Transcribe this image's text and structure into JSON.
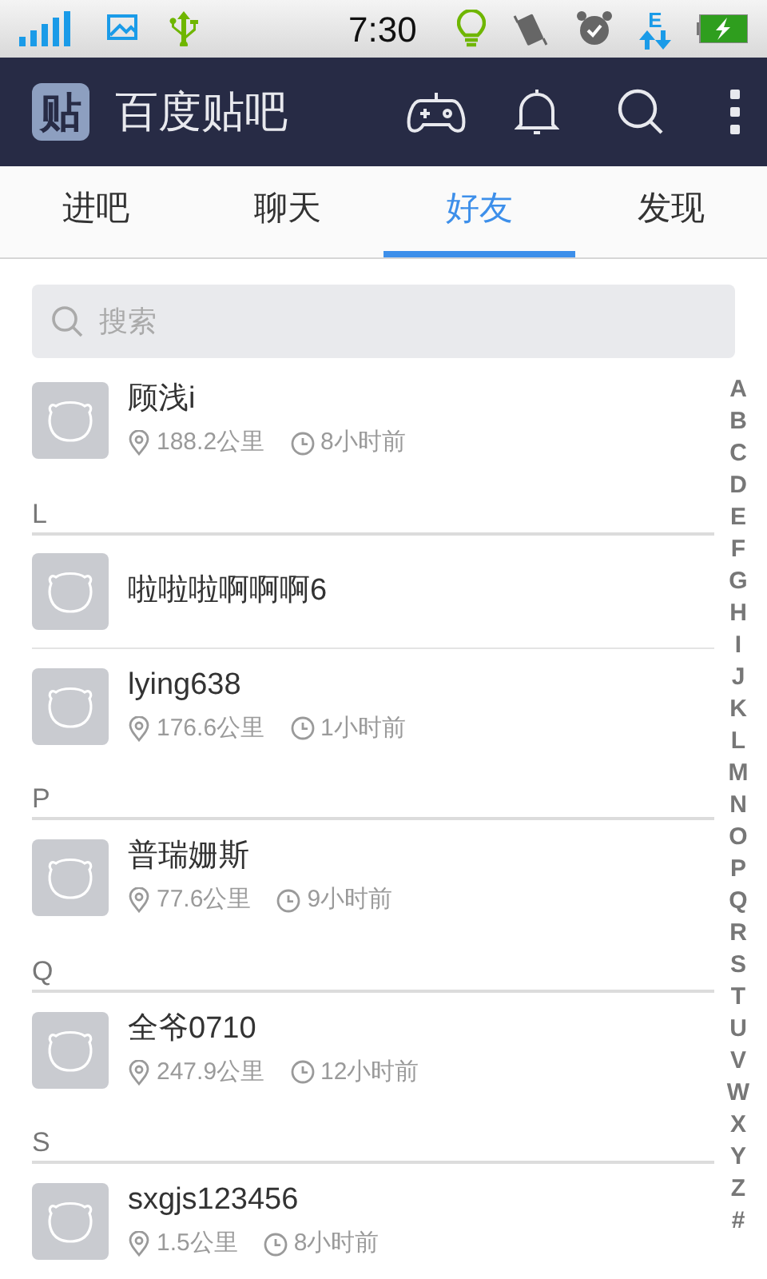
{
  "status_bar": {
    "time": "7:30",
    "network_type": "E"
  },
  "header": {
    "logo": "贴",
    "title": "百度贴吧"
  },
  "tabs": [
    {
      "label": "进吧",
      "selected": false
    },
    {
      "label": "聊天",
      "selected": false
    },
    {
      "label": "好友",
      "selected": true
    },
    {
      "label": "发现",
      "selected": false
    }
  ],
  "search": {
    "placeholder": "搜索"
  },
  "list": [
    {
      "kind": "contact",
      "name": "顾浅i",
      "distance": "188.2公里",
      "time": "8小时前"
    },
    {
      "kind": "section",
      "label": "L"
    },
    {
      "kind": "contact",
      "name": "啦啦啦啊啊啊6"
    },
    {
      "kind": "contact",
      "name": "lying638",
      "distance": "176.6公里",
      "time": "1小时前"
    },
    {
      "kind": "section",
      "label": "P"
    },
    {
      "kind": "contact",
      "name": "普瑞姗斯",
      "distance": "77.6公里",
      "time": "9小时前"
    },
    {
      "kind": "section",
      "label": "Q"
    },
    {
      "kind": "contact",
      "name": "全爷0710",
      "distance": "247.9公里",
      "time": "12小时前"
    },
    {
      "kind": "section",
      "label": "S"
    },
    {
      "kind": "contact",
      "name": "sxgjs123456",
      "distance": "1.5公里",
      "time": "8小时前"
    }
  ],
  "index": [
    "A",
    "B",
    "C",
    "D",
    "E",
    "F",
    "G",
    "H",
    "I",
    "J",
    "K",
    "L",
    "M",
    "N",
    "O",
    "P",
    "Q",
    "R",
    "S",
    "T",
    "U",
    "V",
    "W",
    "X",
    "Y",
    "Z",
    "#"
  ]
}
